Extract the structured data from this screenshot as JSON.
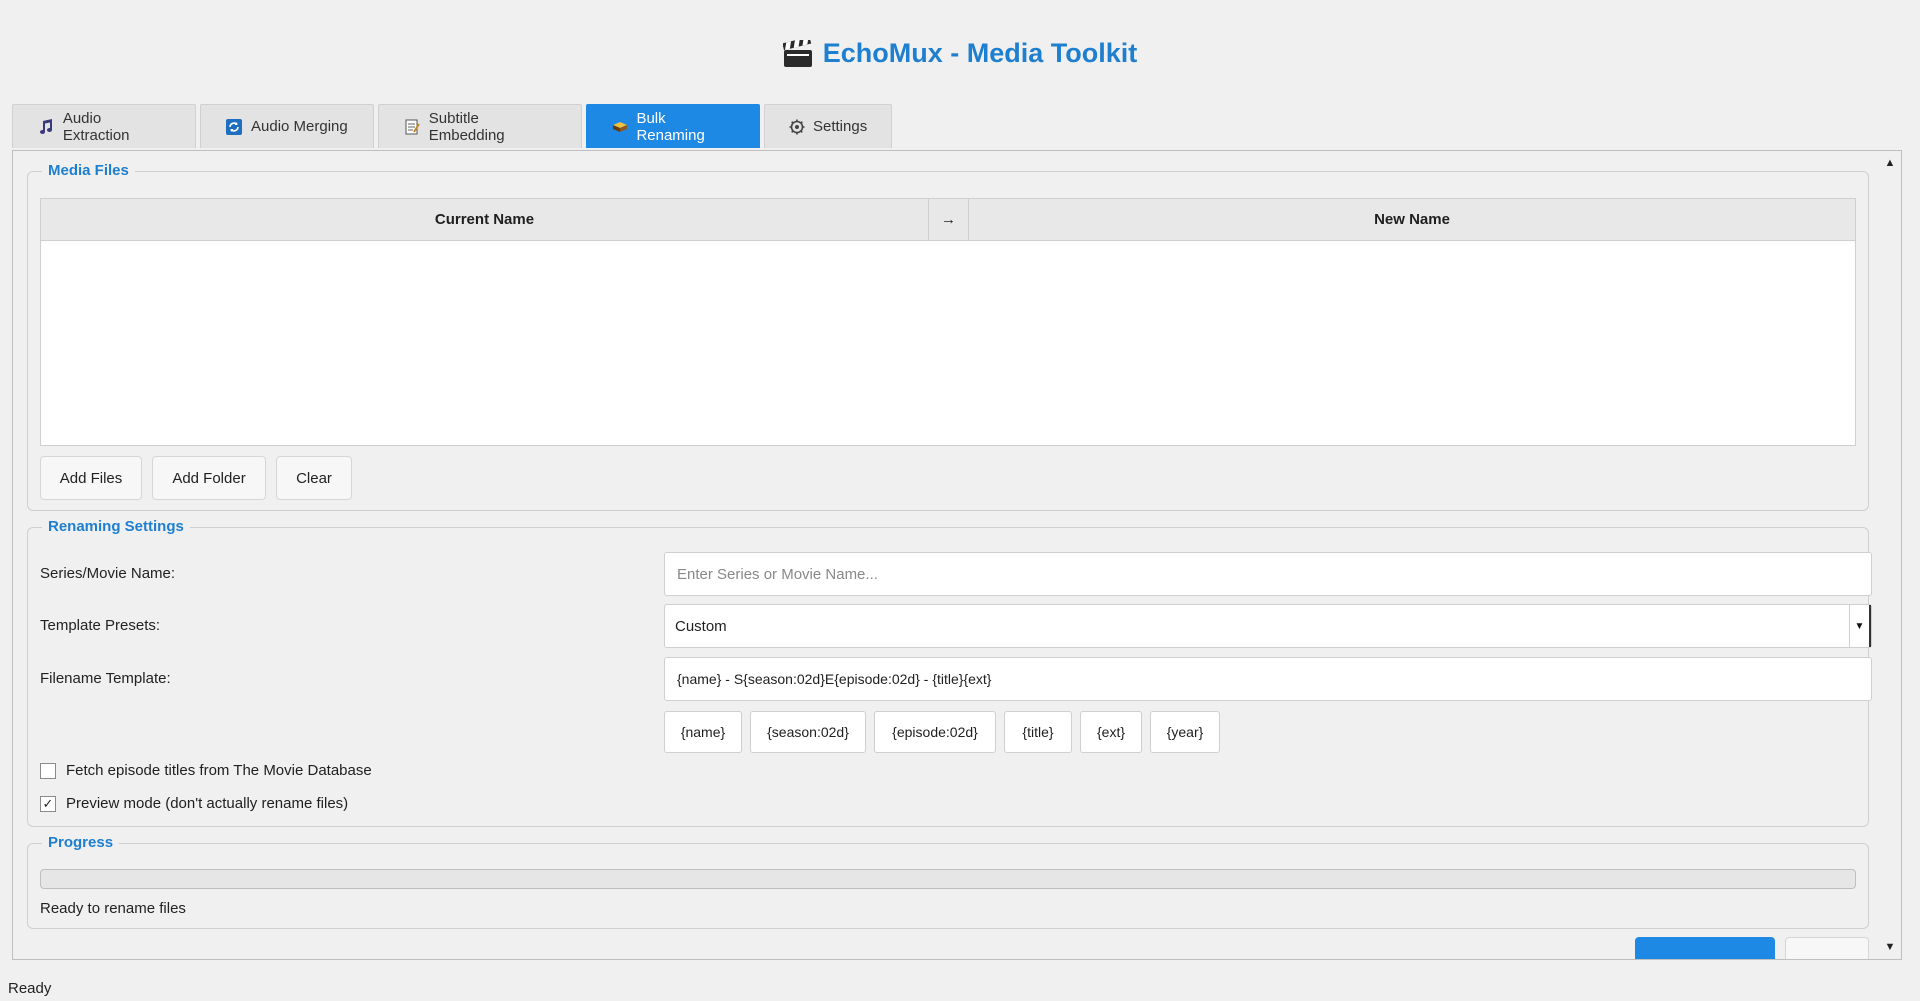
{
  "app": {
    "title": "EchoMux - Media Toolkit",
    "title_icon": "clapperboard-icon",
    "accent_color": "#1e88e5"
  },
  "tabs": [
    {
      "label": "Audio Extraction",
      "icon": "music-note-icon",
      "active": false
    },
    {
      "label": "Audio Merging",
      "icon": "sync-arrows-icon",
      "active": false
    },
    {
      "label": "Subtitle Embedding",
      "icon": "memo-icon",
      "active": false
    },
    {
      "label": "Bulk Renaming",
      "icon": "book-icon",
      "active": true
    },
    {
      "label": "Settings",
      "icon": "gear-icon",
      "active": false
    }
  ],
  "media_files": {
    "legend": "Media Files",
    "columns": {
      "current": "Current Name",
      "arrow": "→",
      "new": "New Name"
    },
    "rows": [],
    "buttons": {
      "add_files": "Add Files",
      "add_folder": "Add Folder",
      "clear": "Clear"
    }
  },
  "renaming": {
    "legend": "Renaming Settings",
    "series_label": "Series/Movie Name:",
    "series_placeholder": "Enter Series or Movie Name...",
    "series_value": "",
    "presets_label": "Template Presets:",
    "presets_value": "Custom",
    "template_label": "Filename Template:",
    "template_value": "{name} - S{season:02d}E{episode:02d} - {title}{ext}",
    "tokens": [
      "{name}",
      "{season:02d}",
      "{episode:02d}",
      "{title}",
      "{ext}",
      "{year}"
    ],
    "fetch_label": "Fetch episode titles from The Movie Database",
    "fetch_checked": false,
    "preview_label": "Preview mode (don't actually rename files)",
    "preview_checked": true
  },
  "progress": {
    "legend": "Progress",
    "fraction": 0,
    "status_text": "Ready to rename files"
  },
  "statusbar": {
    "text": "Ready"
  }
}
